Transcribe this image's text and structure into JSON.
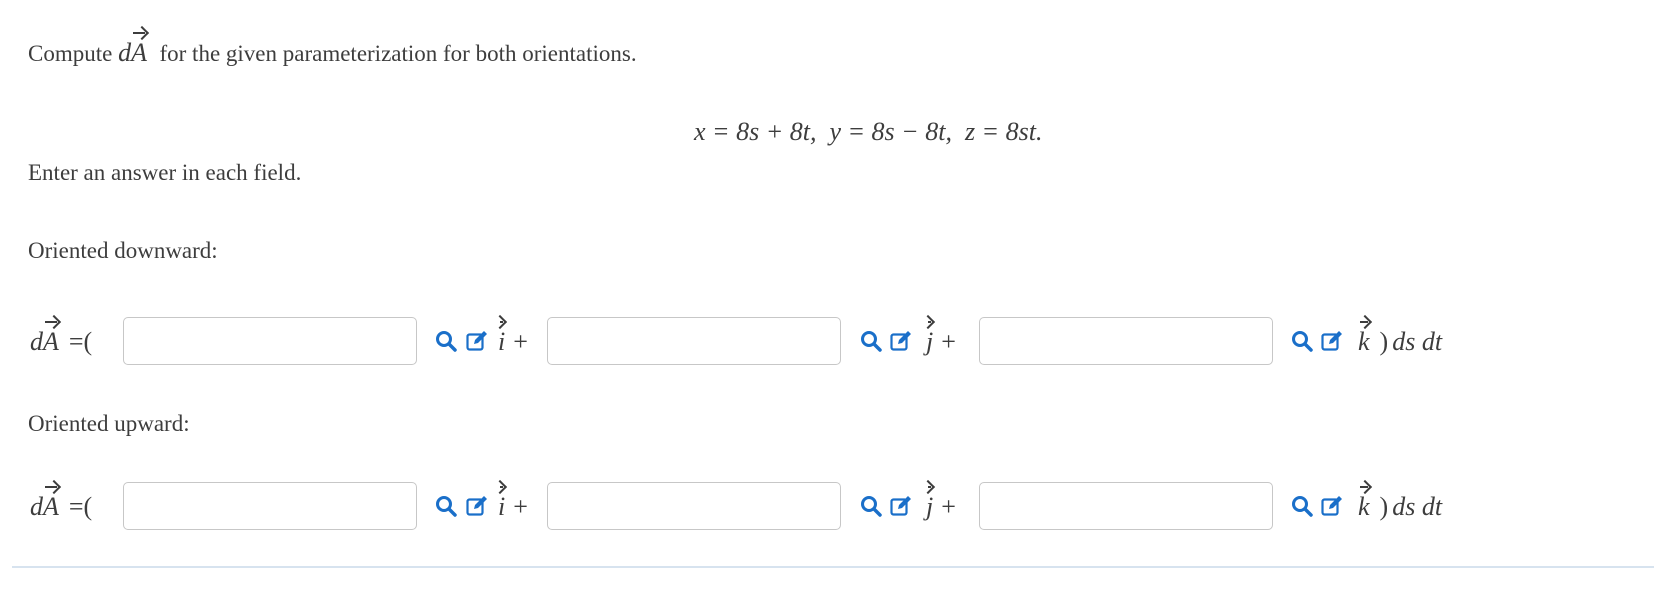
{
  "prompt": {
    "before": "Compute",
    "symbol_d": "d",
    "symbol_A": "A",
    "after": "for the given parameterization for both orientations."
  },
  "equation": "x = 8s + 8t,  y = 8s − 8t,  z = 8st.",
  "instruction": "Enter an answer in each field.",
  "sections": [
    {
      "heading": "Oriented downward:",
      "lhs_d": "d",
      "lhs_A": "A",
      "lhs_eq": "=(",
      "components": [
        {
          "unit": "i",
          "trailing": "+",
          "value": ""
        },
        {
          "unit": "j",
          "trailing": "+",
          "value": ""
        },
        {
          "unit": "k",
          "trailing": ")",
          "value": ""
        }
      ],
      "suffix": "ds dt"
    },
    {
      "heading": "Oriented upward:",
      "lhs_d": "d",
      "lhs_A": "A",
      "lhs_eq": "=(",
      "components": [
        {
          "unit": "i",
          "trailing": "+",
          "value": ""
        },
        {
          "unit": "j",
          "trailing": "+",
          "value": ""
        },
        {
          "unit": "k",
          "trailing": ")",
          "value": ""
        }
      ],
      "suffix": "ds dt"
    }
  ],
  "icons": {
    "preview": "magnifier-icon",
    "edit": "edit-pencil-icon"
  },
  "colors": {
    "text": "#3d3d3d",
    "icon_blue": "#1a6fc9",
    "input_border": "#c7c7c7",
    "divider": "#d7e3ef"
  }
}
